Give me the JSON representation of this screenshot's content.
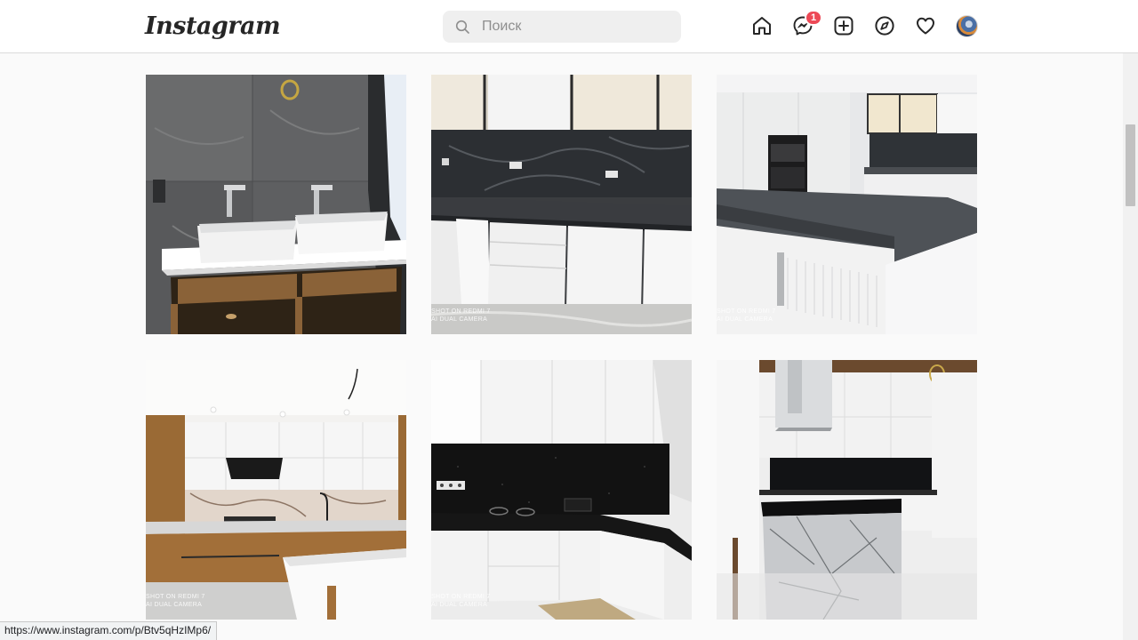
{
  "header": {
    "logo": "Instagram",
    "search": {
      "placeholder": "Поиск",
      "value": ""
    },
    "messages_badge": "1",
    "nav_icons": [
      "home-icon",
      "messenger-icon",
      "new-post-icon",
      "explore-icon",
      "activity-heart-icon",
      "profile-avatar"
    ]
  },
  "posts": [
    {
      "subject": "bathroom-double-sink-vanity",
      "watermark": []
    },
    {
      "subject": "white-kitchen-dark-marble-backsplash",
      "watermark": [
        "SHOT ON REDMI 7",
        "AI DUAL CAMERA"
      ]
    },
    {
      "subject": "white-kitchen-island-built-in-ovens",
      "watermark": [
        "SHOT ON REDMI 7",
        "AI DUAL CAMERA"
      ]
    },
    {
      "subject": "wood-white-kitchen-marble-backsplash",
      "watermark": [
        "SHOT ON REDMI 7",
        "AI DUAL CAMERA"
      ]
    },
    {
      "subject": "white-corner-kitchen-black-worktop",
      "watermark": [
        "SHOT ON REDMI 7",
        "AI DUAL CAMERA"
      ]
    },
    {
      "subject": "kitchen-island-extractor-hood",
      "watermark": []
    }
  ],
  "status_bar": {
    "url": "https://www.instagram.com/p/Btv5qHzIMp6/"
  },
  "colors": {
    "badge": "#ed4956",
    "background": "#fafafa",
    "border": "#dbdbdb",
    "search_bg": "#efefef"
  }
}
